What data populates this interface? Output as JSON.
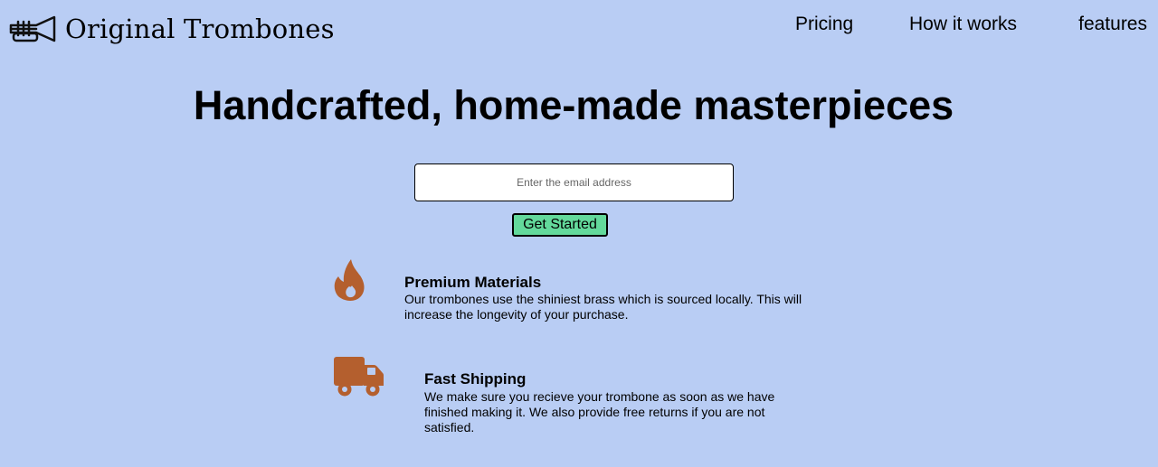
{
  "brand": {
    "name": "Original Trombones",
    "icon": "trumpet-icon"
  },
  "nav": {
    "items": [
      {
        "label": "Pricing"
      },
      {
        "label": "How it works"
      },
      {
        "label": "features"
      }
    ]
  },
  "hero": {
    "title": "Handcrafted, home-made masterpieces",
    "email_placeholder": "Enter the email address",
    "email_value": "",
    "cta_label": "Get Started"
  },
  "features": [
    {
      "icon": "fire-icon",
      "title": "Premium Materials",
      "description": "Our trombones use the shiniest brass which is sourced locally. This will increase the longevity of your purchase."
    },
    {
      "icon": "truck-icon",
      "title": "Fast Shipping",
      "description": "We make sure you recieve your trombone as soon as we have finished making it. We also provide free returns if you are not satisfied."
    }
  ],
  "colors": {
    "background": "#b9cdf4",
    "accent_icon": "#b45f2e",
    "cta_background": "#63d99b",
    "input_background": "#ffffff"
  }
}
